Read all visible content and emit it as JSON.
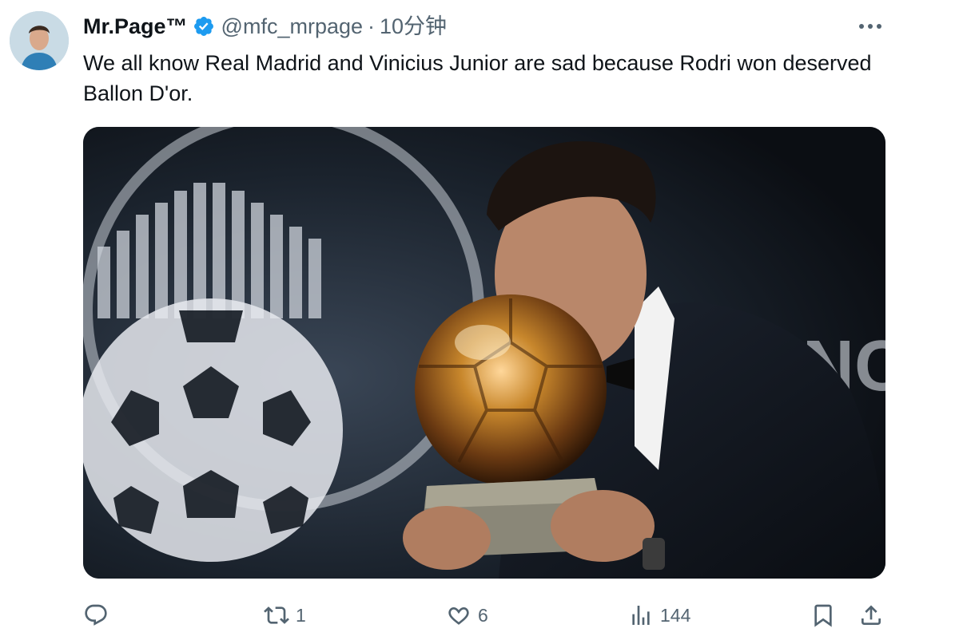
{
  "tweet": {
    "display_name": "Mr.Page™",
    "handle": "@mfc_mrpage",
    "separator": "·",
    "time": "10分钟",
    "text": "We all know Real Madrid and Vinicius Junior are sad because Rodri won deserved Ballon D'or.",
    "verified": true
  },
  "actions": {
    "reply": {
      "icon": "reply-icon",
      "count": ""
    },
    "retweet": {
      "icon": "retweet-icon",
      "count": "1"
    },
    "like": {
      "icon": "heart-icon",
      "count": "6"
    },
    "views": {
      "icon": "views-icon",
      "count": "144"
    },
    "bookmark": {
      "icon": "bookmark-icon"
    },
    "share": {
      "icon": "share-icon"
    }
  },
  "colors": {
    "verified_badge": "#1d9bf0",
    "secondary_text": "#536471",
    "primary_text": "#0f1419"
  }
}
